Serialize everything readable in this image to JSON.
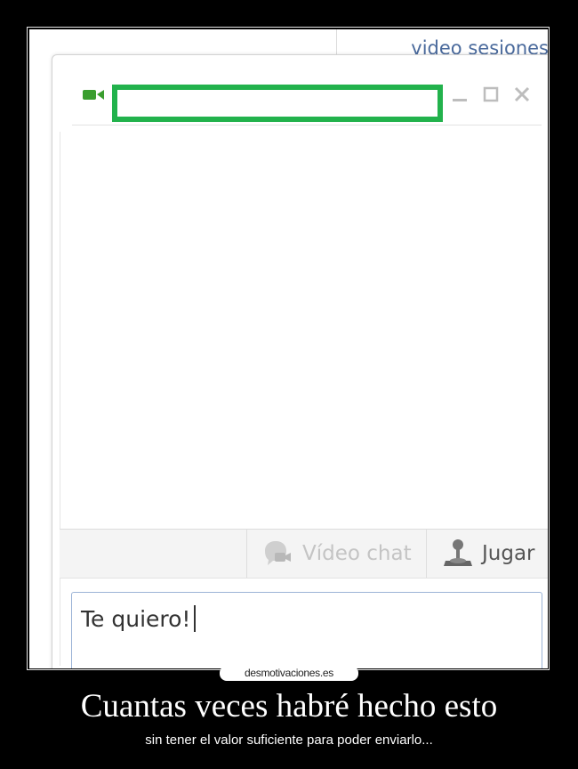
{
  "top_bar": {
    "link_text": "video sesiones"
  },
  "chat_window": {
    "contact_name": "",
    "action_bar": {
      "video_chat_label": "Vídeo chat",
      "play_label": "Jugar"
    },
    "message_input": {
      "value": "Te quiero!"
    }
  },
  "poster": {
    "watermark": "desmotivaciones.es",
    "caption": "Cuantas veces habré hecho esto",
    "subcaption": "sin tener el valor suficiente para poder enviarlo..."
  },
  "icons": {
    "camera": "video-camera-icon",
    "minimize": "minimize-icon",
    "maximize": "maximize-icon",
    "close": "close-icon",
    "video_chat": "video-chat-icon",
    "joystick": "joystick-icon"
  },
  "colors": {
    "name_highlight": "#22b24c",
    "camera_icon": "#3a9e2f",
    "link": "#4a6a9c",
    "input_border": "#9bb3d6",
    "background": "#000000",
    "caption_text": "#ffffff"
  }
}
